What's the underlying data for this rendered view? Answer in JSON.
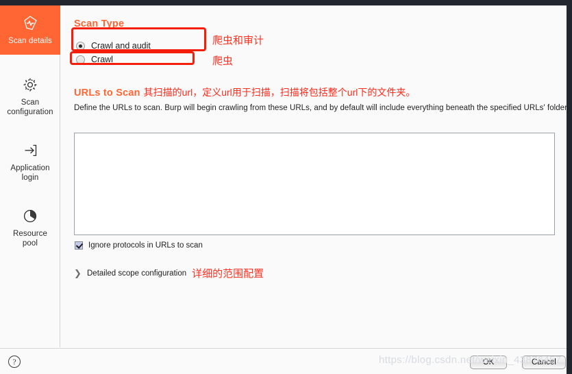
{
  "sidebar": {
    "items": [
      {
        "label": "Scan details",
        "icon": "scan-details-icon",
        "active": true
      },
      {
        "label": "Scan\nconfiguration",
        "icon": "gear-icon",
        "active": false
      },
      {
        "label": "Application\nlogin",
        "icon": "login-arrow-icon",
        "active": false
      },
      {
        "label": "Resource\npool",
        "icon": "pie-chart-icon",
        "active": false
      }
    ],
    "labels": {
      "scan_details": "Scan details",
      "scan_configuration_line1": "Scan",
      "scan_configuration_line2": "configuration",
      "application_login_line1": "Application",
      "application_login_line2": "login",
      "resource_pool_line1": "Resource",
      "resource_pool_line2": "pool"
    }
  },
  "main": {
    "scan_type": {
      "heading": "Scan Type",
      "options": [
        {
          "label": "Crawl and audit",
          "selected": true,
          "annotation": "爬虫和审计"
        },
        {
          "label": "Crawl",
          "selected": false,
          "annotation": "爬虫"
        }
      ]
    },
    "urls_to_scan": {
      "heading": "URLs to Scan",
      "heading_annotation": "其扫描的url，定义url用于扫描，扫描将包括整个url下的文件夹。",
      "description": "Define the URLs to scan. Burp will begin crawling from these URLs, and by default will include everything beneath the specified URLs' folders.",
      "textarea_value": "",
      "textarea_placeholder": ""
    },
    "ignore_protocols": {
      "label": "Ignore protocols in URLs to scan",
      "checked": true
    },
    "detailed_scope": {
      "label": "Detailed scope configuration",
      "annotation": "详细的范围配置",
      "chevron": "❯",
      "expanded": false
    }
  },
  "footer": {
    "help_icon_glyph": "?",
    "ok_label": "OK",
    "cancel_label": "Cancel"
  },
  "overlay": {
    "watermark": "https://blog.csdn.net/weixin_43876457"
  },
  "colors": {
    "accent_orange": "#ff6633",
    "annotation_red": "#ff3322",
    "anno_box_red": "#f41e0c",
    "panel_bg": "#fafafa",
    "frame_dark": "#22262e"
  }
}
